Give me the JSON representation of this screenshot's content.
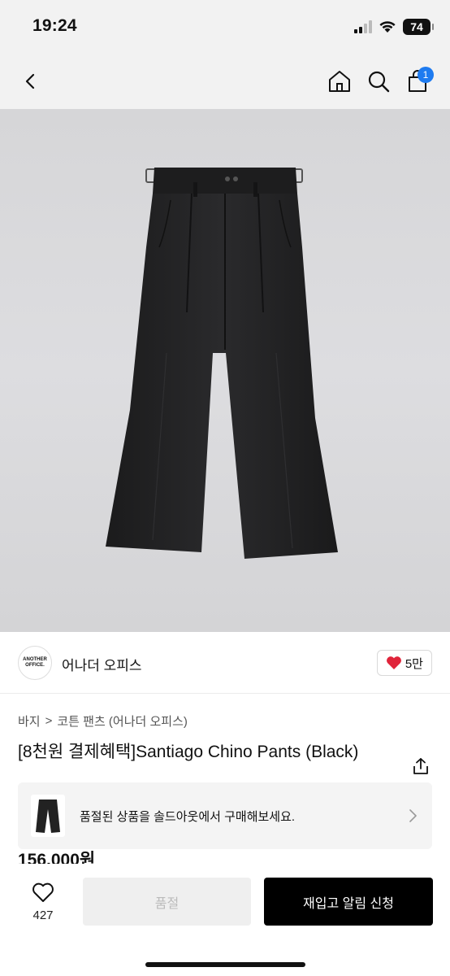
{
  "status": {
    "time": "19:24",
    "battery": "74"
  },
  "nav": {
    "cart_count": "1"
  },
  "brand": {
    "logo_line1": "ANOTHER",
    "logo_line2": "OFFICE.",
    "name": "어나더 오피스",
    "likes": "5만"
  },
  "breadcrumb": {
    "level1": "바지",
    "separator": ">",
    "level2": "코튼 팬츠 (어나더 오피스)"
  },
  "product": {
    "title": "[8천원 결제혜택]Santiago Chino Pants (Black)",
    "price": "156,000원"
  },
  "banner": {
    "text": "품절된 상품을 솔드아웃에서 구매해보세요."
  },
  "bottom": {
    "wish_count": "427",
    "soldout_label": "품절",
    "restock_label": "재입고 알림 신청"
  },
  "colors": {
    "accent_badge": "#1e7bf0",
    "heart": "#e0243a",
    "primary_button": "#000000"
  },
  "icons": [
    "back-icon",
    "home-icon",
    "search-icon",
    "cart-icon",
    "heart-icon",
    "share-icon",
    "chevron-right-icon"
  ]
}
